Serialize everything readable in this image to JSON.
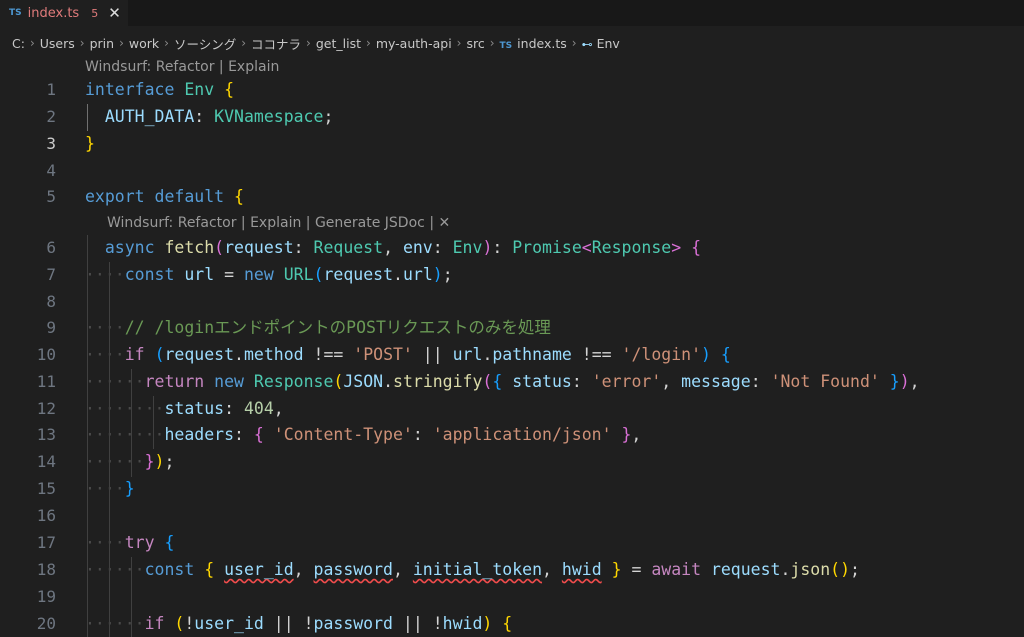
{
  "tab": {
    "lang_badge": "TS",
    "filename": "index.ts",
    "problem_count": "5",
    "close_glyph": "✕"
  },
  "breadcrumb": [
    {
      "label": "C:"
    },
    {
      "label": "Users"
    },
    {
      "label": "prin"
    },
    {
      "label": "work"
    },
    {
      "label": "ソーシング"
    },
    {
      "label": "ココナラ"
    },
    {
      "label": "get_list"
    },
    {
      "label": "my-auth-api"
    },
    {
      "label": "src"
    },
    {
      "label": "index.ts",
      "badge": "TS"
    },
    {
      "label": "Env",
      "symbol": "⊷"
    }
  ],
  "codelens": {
    "first": {
      "windsurf": "Windsurf:",
      "refactor": "Refactor",
      "explain": "Explain",
      "sep": "|"
    },
    "second": {
      "windsurf": "Windsurf:",
      "refactor": "Refactor",
      "explain": "Explain",
      "generate": "Generate JSDoc",
      "sep": "|",
      "close": "✕"
    }
  },
  "lines": [
    {
      "n": 1,
      "tokens": [
        [
          "kw",
          "interface"
        ],
        [
          "",
          " "
        ],
        [
          "ty",
          "Env"
        ],
        [
          "",
          " "
        ],
        [
          "b1",
          "{"
        ]
      ]
    },
    {
      "n": 2,
      "tokens": [
        [
          "ws",
          "  "
        ],
        [
          "var",
          "AUTH_DATA"
        ],
        [
          "",
          ": "
        ],
        [
          "ty",
          "KVNamespace"
        ],
        [
          "",
          ";"
        ]
      ]
    },
    {
      "n": 3,
      "active": true,
      "tokens": [
        [
          "b1",
          "}"
        ]
      ]
    },
    {
      "n": 4,
      "tokens": []
    },
    {
      "n": 5,
      "tokens": [
        [
          "kw",
          "export"
        ],
        [
          "",
          " "
        ],
        [
          "kw",
          "default"
        ],
        [
          "",
          " "
        ],
        [
          "b1",
          "{"
        ]
      ]
    },
    {
      "n": 6,
      "tokens": [
        [
          "ws",
          "  "
        ],
        [
          "kw",
          "async"
        ],
        [
          "",
          " "
        ],
        [
          "fn",
          "fetch"
        ],
        [
          "b2",
          "("
        ],
        [
          "var",
          "request"
        ],
        [
          "",
          ": "
        ],
        [
          "ty",
          "Request"
        ],
        [
          "",
          ", "
        ],
        [
          "var",
          "env"
        ],
        [
          "",
          ": "
        ],
        [
          "ty",
          "Env"
        ],
        [
          "b2",
          ")"
        ],
        [
          "",
          ": "
        ],
        [
          "ty",
          "Promise"
        ],
        [
          "b2",
          "<"
        ],
        [
          "ty",
          "Response"
        ],
        [
          "b2",
          ">"
        ],
        [
          "",
          " "
        ],
        [
          "b2",
          "{"
        ]
      ]
    },
    {
      "n": 7,
      "tokens": [
        [
          "ws",
          "····"
        ],
        [
          "kw",
          "const"
        ],
        [
          "",
          " "
        ],
        [
          "var",
          "url"
        ],
        [
          "",
          " = "
        ],
        [
          "kw",
          "new"
        ],
        [
          "",
          " "
        ],
        [
          "ty",
          "URL"
        ],
        [
          "b3",
          "("
        ],
        [
          "var",
          "request"
        ],
        [
          "",
          "."
        ],
        [
          "prop",
          "url"
        ],
        [
          "b3",
          ")"
        ],
        [
          "",
          ";"
        ]
      ]
    },
    {
      "n": 8,
      "tokens": []
    },
    {
      "n": 9,
      "tokens": [
        [
          "ws",
          "····"
        ],
        [
          "com",
          "// /loginエンドポイントのPOSTリクエストのみを処理"
        ]
      ]
    },
    {
      "n": 10,
      "tokens": [
        [
          "ws",
          "····"
        ],
        [
          "ctl",
          "if"
        ],
        [
          "",
          " "
        ],
        [
          "b3",
          "("
        ],
        [
          "var",
          "request"
        ],
        [
          "",
          "."
        ],
        [
          "prop",
          "method"
        ],
        [
          "",
          " !== "
        ],
        [
          "str",
          "'POST'"
        ],
        [
          "",
          " || "
        ],
        [
          "var",
          "url"
        ],
        [
          "",
          "."
        ],
        [
          "prop",
          "pathname"
        ],
        [
          "",
          " !== "
        ],
        [
          "str",
          "'/login'"
        ],
        [
          "b3",
          ")"
        ],
        [
          "",
          " "
        ],
        [
          "b3",
          "{"
        ]
      ]
    },
    {
      "n": 11,
      "tokens": [
        [
          "ws",
          "······"
        ],
        [
          "ctl",
          "return"
        ],
        [
          "",
          " "
        ],
        [
          "kw",
          "new"
        ],
        [
          "",
          " "
        ],
        [
          "ty",
          "Response"
        ],
        [
          "b1",
          "("
        ],
        [
          "var",
          "JSON"
        ],
        [
          "",
          "."
        ],
        [
          "fn",
          "stringify"
        ],
        [
          "b2",
          "("
        ],
        [
          "b3",
          "{"
        ],
        [
          "",
          " "
        ],
        [
          "prop",
          "status"
        ],
        [
          "",
          ": "
        ],
        [
          "str",
          "'error'"
        ],
        [
          "",
          ", "
        ],
        [
          "prop",
          "message"
        ],
        [
          "",
          ": "
        ],
        [
          "str",
          "'Not Found'"
        ],
        [
          "",
          " "
        ],
        [
          "b3",
          "}"
        ],
        [
          "b2",
          ")"
        ],
        [
          "",
          ","
        ]
      ]
    },
    {
      "n": 12,
      "tokens": [
        [
          "ws",
          "········"
        ],
        [
          "prop",
          "status"
        ],
        [
          "",
          ": "
        ],
        [
          "num",
          "404"
        ],
        [
          "",
          ","
        ]
      ]
    },
    {
      "n": 13,
      "tokens": [
        [
          "ws",
          "········"
        ],
        [
          "prop",
          "headers"
        ],
        [
          "",
          ": "
        ],
        [
          "b2",
          "{"
        ],
        [
          "",
          " "
        ],
        [
          "str",
          "'Content-Type'"
        ],
        [
          "",
          ": "
        ],
        [
          "str",
          "'application/json'"
        ],
        [
          "",
          " "
        ],
        [
          "b2",
          "}"
        ],
        [
          "",
          ","
        ]
      ]
    },
    {
      "n": 14,
      "tokens": [
        [
          "ws",
          "······"
        ],
        [
          "b2",
          "}"
        ],
        [
          "b1",
          ")"
        ],
        [
          "",
          ";"
        ]
      ]
    },
    {
      "n": 15,
      "tokens": [
        [
          "ws",
          "····"
        ],
        [
          "b3",
          "}"
        ]
      ]
    },
    {
      "n": 16,
      "tokens": []
    },
    {
      "n": 17,
      "tokens": [
        [
          "ws",
          "····"
        ],
        [
          "ctl",
          "try"
        ],
        [
          "",
          " "
        ],
        [
          "b3",
          "{"
        ]
      ]
    },
    {
      "n": 18,
      "tokens": [
        [
          "ws",
          "······"
        ],
        [
          "kw",
          "const"
        ],
        [
          "",
          " "
        ],
        [
          "b1",
          "{"
        ],
        [
          "",
          " "
        ],
        [
          "var sq",
          "user_id"
        ],
        [
          "",
          ", "
        ],
        [
          "var sq",
          "password"
        ],
        [
          "",
          ", "
        ],
        [
          "var sq",
          "initial_token"
        ],
        [
          "",
          ", "
        ],
        [
          "var sq",
          "hwid"
        ],
        [
          "",
          " "
        ],
        [
          "b1",
          "}"
        ],
        [
          "",
          " = "
        ],
        [
          "ctl",
          "await"
        ],
        [
          "",
          " "
        ],
        [
          "var",
          "request"
        ],
        [
          "",
          "."
        ],
        [
          "fn",
          "json"
        ],
        [
          "b1",
          "()"
        ],
        [
          "",
          ";"
        ]
      ]
    },
    {
      "n": 19,
      "tokens": []
    },
    {
      "n": 20,
      "tokens": [
        [
          "ws",
          "······"
        ],
        [
          "ctl",
          "if"
        ],
        [
          "",
          " "
        ],
        [
          "b1",
          "("
        ],
        [
          "",
          "!"
        ],
        [
          "var",
          "user_id"
        ],
        [
          "",
          " || !"
        ],
        [
          "var",
          "password"
        ],
        [
          "",
          " || !"
        ],
        [
          "var",
          "hwid"
        ],
        [
          "b1",
          ")"
        ],
        [
          "",
          " "
        ],
        [
          "b1",
          "{"
        ]
      ]
    }
  ]
}
